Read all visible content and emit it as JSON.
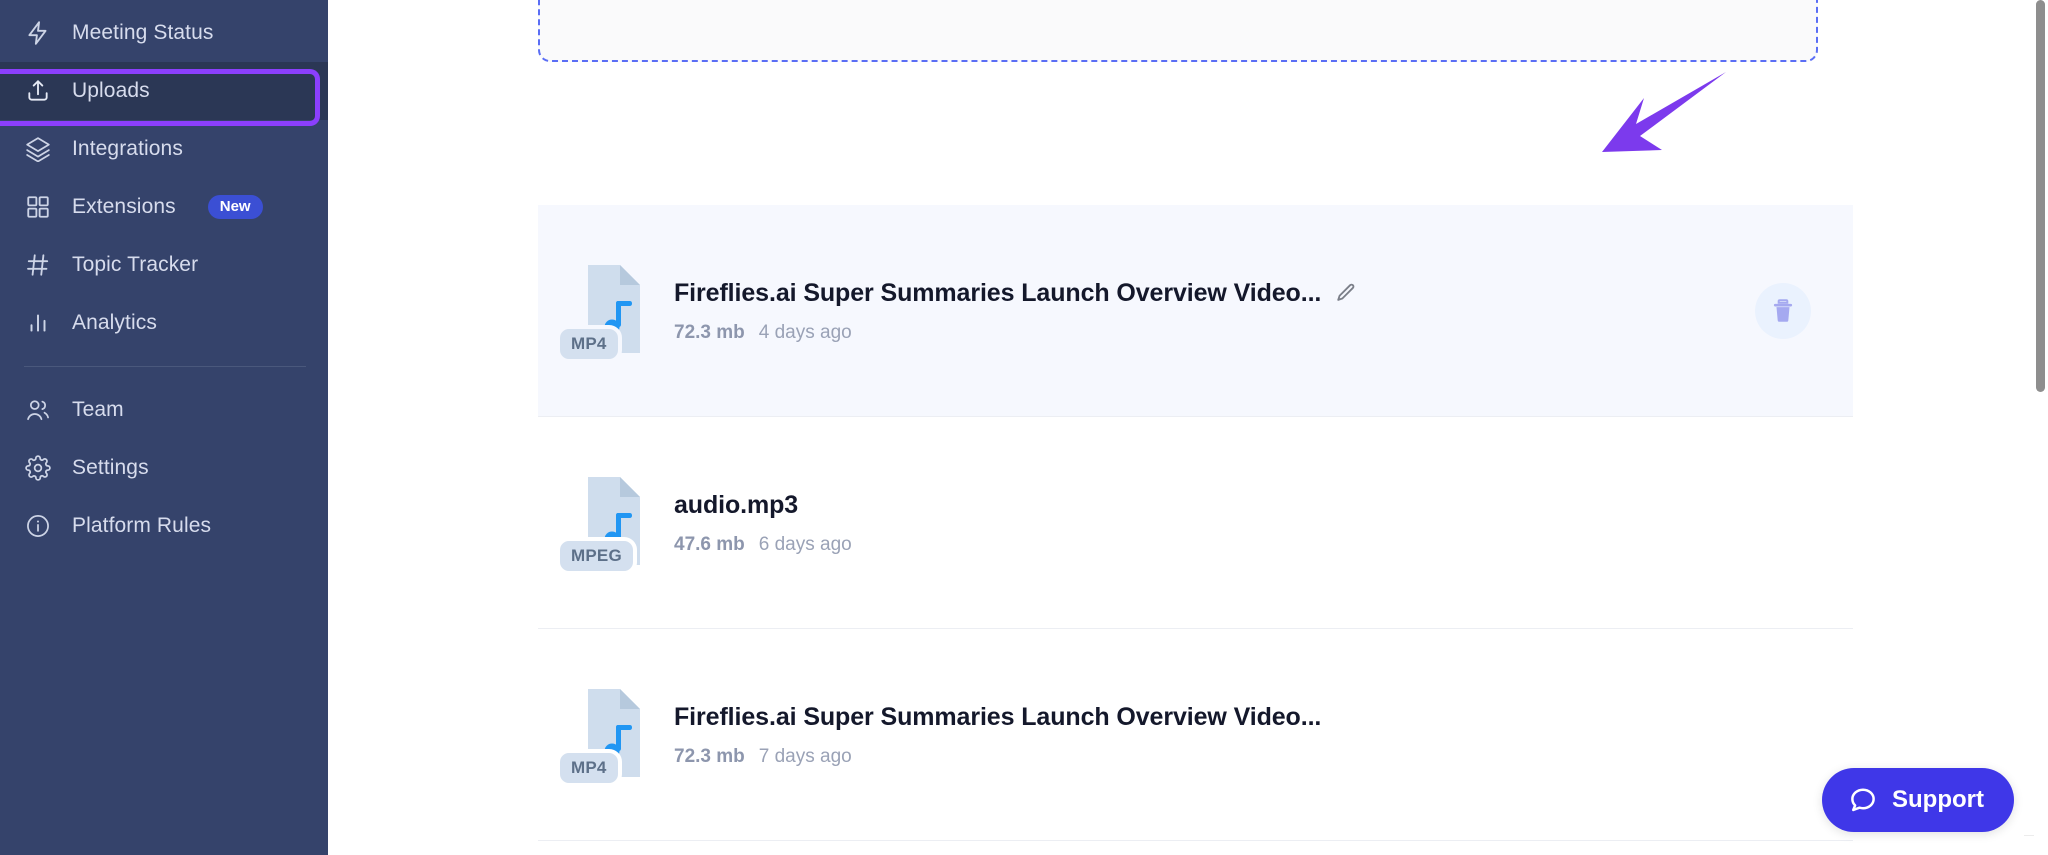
{
  "sidebar": {
    "items": [
      {
        "id": "meeting-status",
        "label": "Meeting Status",
        "icon": "lightning-icon",
        "active": false,
        "badge": null
      },
      {
        "id": "uploads",
        "label": "Uploads",
        "icon": "upload-icon",
        "active": true,
        "badge": null
      },
      {
        "id": "integrations",
        "label": "Integrations",
        "icon": "layers-icon",
        "active": false,
        "badge": null
      },
      {
        "id": "extensions",
        "label": "Extensions",
        "icon": "grid-icon",
        "active": false,
        "badge": "New"
      },
      {
        "id": "topic-tracker",
        "label": "Topic Tracker",
        "icon": "hash-icon",
        "active": false,
        "badge": null
      },
      {
        "id": "analytics",
        "label": "Analytics",
        "icon": "bar-chart-icon",
        "active": false,
        "badge": null
      },
      {
        "id": "team",
        "label": "Team",
        "icon": "people-icon",
        "active": false,
        "badge": null
      },
      {
        "id": "settings",
        "label": "Settings",
        "icon": "gear-icon",
        "active": false,
        "badge": null
      },
      {
        "id": "platform-rules",
        "label": "Platform Rules",
        "icon": "info-icon",
        "active": false,
        "badge": null
      }
    ],
    "colors": {
      "background": "#35436b",
      "active_background": "#2b3755",
      "highlight_border": "#8b3ffc",
      "badge_background": "#3b4fd4",
      "text": "#d7dced"
    }
  },
  "annotation": {
    "arrow_color": "#7c3aed",
    "direction": "down-left"
  },
  "dropzone": {
    "border_style": "dashed",
    "border_color": "#5b6ef5",
    "background": "#fafafb"
  },
  "uploads": {
    "files": [
      {
        "title": "Fireflies.ai Super Summaries Launch Overview Video...",
        "format": "MP4",
        "size": "72.3 mb",
        "age": "4 days ago",
        "highlighted": true,
        "has_edit_icon": true,
        "has_delete_icon": true
      },
      {
        "title": "audio.mp3",
        "format": "MPEG",
        "size": "47.6 mb",
        "age": "6 days ago",
        "highlighted": false,
        "has_edit_icon": false,
        "has_delete_icon": false
      },
      {
        "title": "Fireflies.ai Super Summaries Launch Overview Video...",
        "format": "MP4",
        "size": "72.3 mb",
        "age": "7 days ago",
        "highlighted": false,
        "has_edit_icon": false,
        "has_delete_icon": false
      }
    ]
  },
  "support": {
    "label": "Support",
    "icon": "chat-bubble-icon",
    "color": "#3f37e8"
  },
  "scrollbar": {
    "thumb_color": "#8e8e8e"
  }
}
